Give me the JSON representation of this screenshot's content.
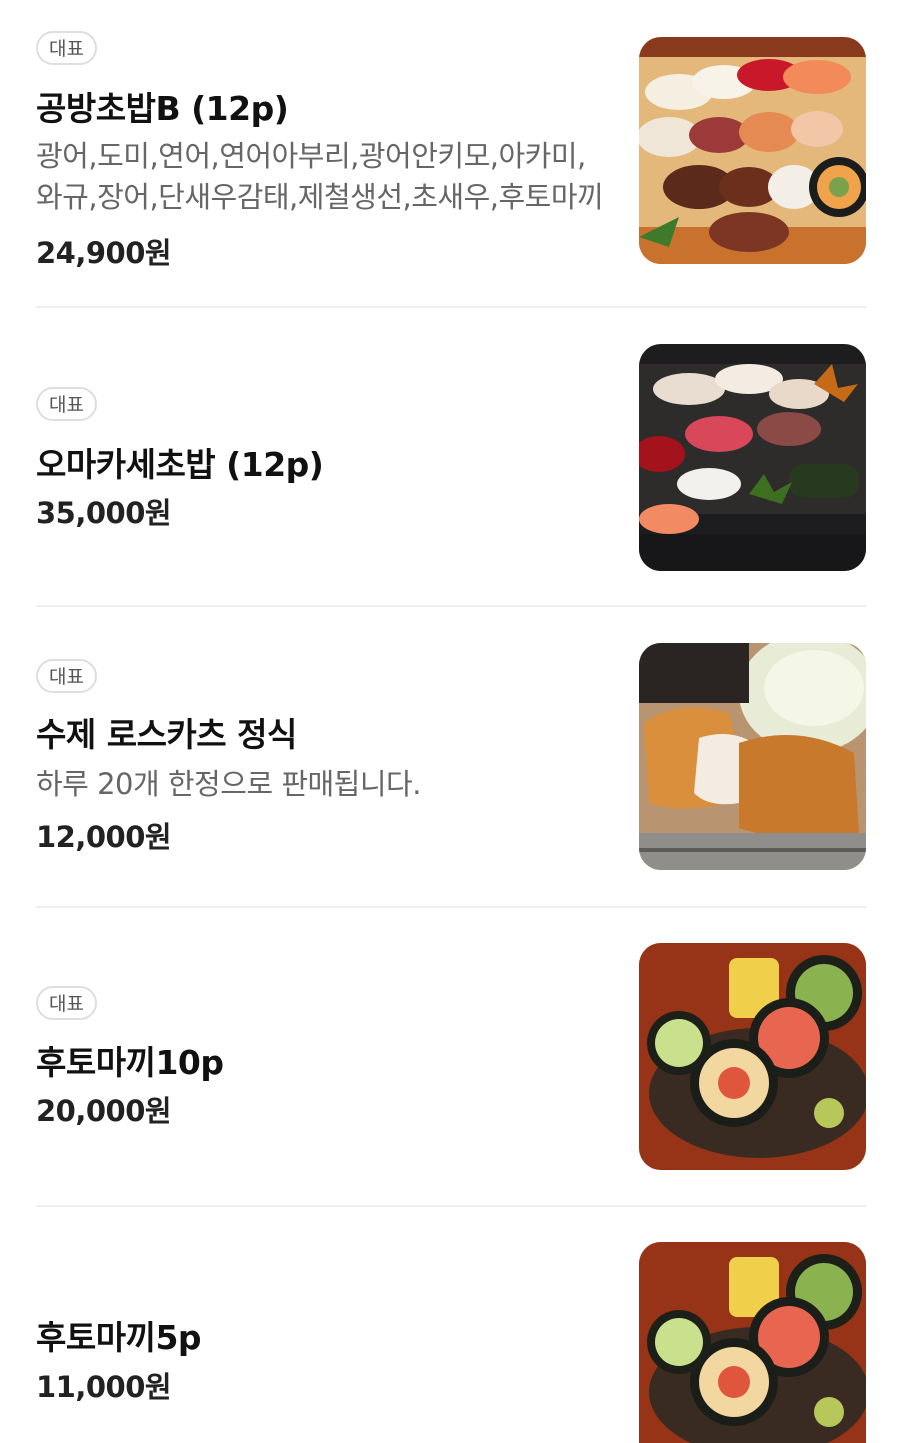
{
  "menu": {
    "items": [
      {
        "badge": "대표",
        "name": "공방초밥B (12p)",
        "description": "광어,도미,연어,연어아부리,광어안키모,아카미,와규,장어,단새우감태,제철생선,초새우,후토마끼",
        "price": "24,900원",
        "image": "sushi-platter-photo"
      },
      {
        "badge": "대표",
        "name": "오마카세초밥 (12p)",
        "description": "",
        "price": "35,000원",
        "image": "omakase-sushi-photo"
      },
      {
        "badge": "대표",
        "name": "수제 로스카츠 정식",
        "description": "하루 20개 한정으로 판매됩니다.",
        "price": "12,000원",
        "image": "pork-cutlet-photo"
      },
      {
        "badge": "대표",
        "name": "후토마끼10p",
        "description": "",
        "price": "20,000원",
        "image": "futomaki-photo"
      },
      {
        "badge": "",
        "name": "후토마끼5p",
        "description": "",
        "price": "11,000원",
        "image": "futomaki-photo"
      }
    ]
  }
}
